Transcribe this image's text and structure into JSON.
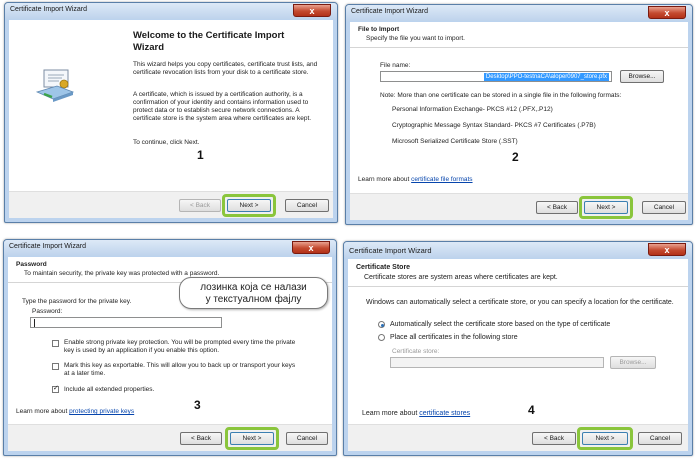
{
  "window_title": "Certificate Import Wizard",
  "buttons": {
    "back": "< Back",
    "next": "Next >",
    "cancel": "Cancel",
    "browse": "Browse..."
  },
  "close_glyph": "x",
  "highlight_color": "#8ac53c",
  "step1": {
    "number": "1",
    "heading": "Welcome to the Certificate Import Wizard",
    "para1": "This wizard helps you copy certificates, certificate trust lists, and certificate revocation lists from your disk to a certificate store.",
    "para2": "A certificate, which is issued by a certification authority, is a confirmation of your identity and contains information used to protect data or to establish secure network connections. A certificate store is the system area where certificates are kept.",
    "para3": "To continue, click Next.",
    "icon": "certificate-icon"
  },
  "step2": {
    "number": "2",
    "header_title": "File to Import",
    "header_subtitle": "Specify the file you want to import.",
    "file_label": "File name:",
    "file_value": "Desktop\\PPO-testnaCA\\aloper0907_store.pfx",
    "note": "Note:  More than one certificate can be stored in a single file in the following formats:",
    "formats": [
      "Personal Information Exchange- PKCS #12 (.PFX,.P12)",
      "Cryptographic Message Syntax Standard- PKCS #7 Certificates (.P7B)",
      "Microsoft Serialized Certificate Store (.SST)"
    ],
    "learn_prefix": "Learn more about ",
    "learn_link": "certificate file formats"
  },
  "step3": {
    "number": "3",
    "header_title": "Password",
    "header_subtitle": "To maintain security, the private key was protected with a password.",
    "type_password": "Type the password for the private key.",
    "password_label": "Password:",
    "password_value": "",
    "options": [
      {
        "label": "Enable strong private key protection. You will be prompted every time the private key is used by an application if you enable this option.",
        "checked": false
      },
      {
        "label": "Mark this key as exportable. This will allow you to back up or transport your keys at a later time.",
        "checked": false
      },
      {
        "label": "Include all extended properties.",
        "checked": true
      }
    ],
    "learn_prefix": "Learn more about ",
    "learn_link": "protecting private keys",
    "callout": "лозинка која се налази\nу текстуалном фајлу"
  },
  "step4": {
    "number": "4",
    "header_title": "Certificate Store",
    "header_subtitle": "Certificate stores are system areas where certificates are kept.",
    "intro": "Windows can automatically select a certificate store, or you can specify a location for the certificate.",
    "radio_auto": "Automatically select the certificate store based on the type of certificate",
    "radio_place": "Place all certificates in the following store",
    "selected": "auto",
    "store_label": "Certificate store:",
    "store_value": "",
    "learn_prefix": "Learn more about ",
    "learn_link": "certificate stores"
  }
}
